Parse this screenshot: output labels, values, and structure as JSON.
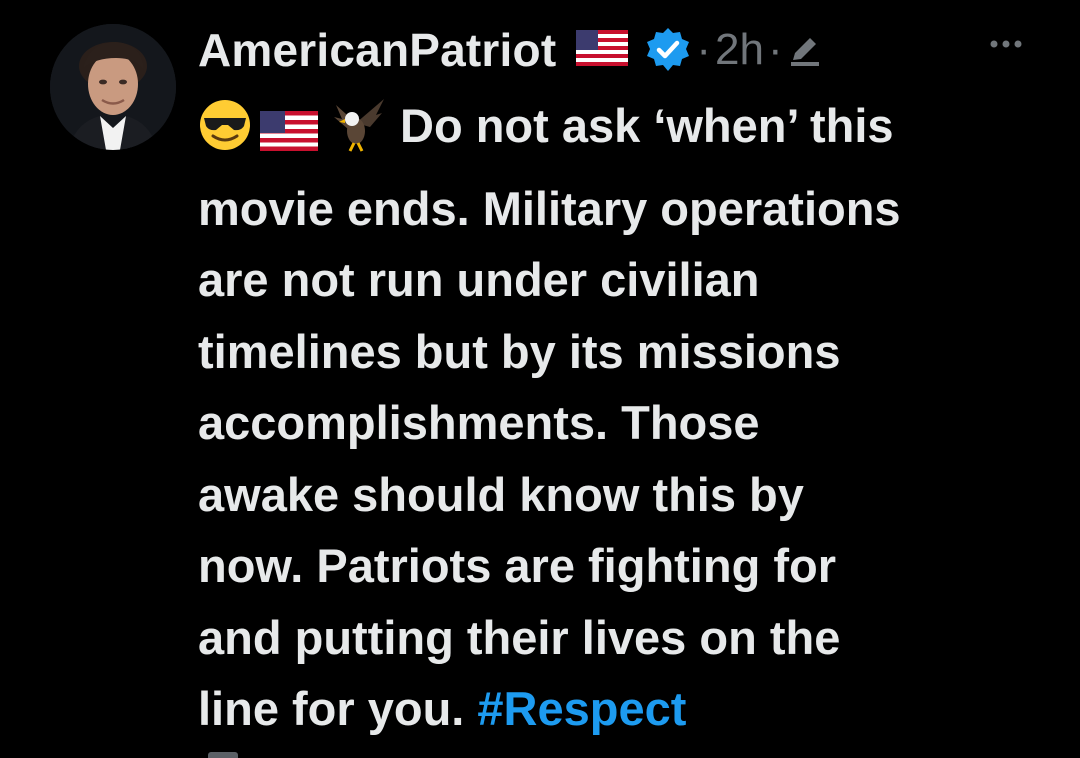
{
  "tweet": {
    "author": {
      "display_name": "AmericanPatriot",
      "badges": [
        "us-flag-emoji",
        "verified-badge"
      ],
      "avatar": "profile-photo"
    },
    "time_separator": "·",
    "relative_time": "2h",
    "separator2": "·",
    "edited_icon": "pencil-icon",
    "more_icon": "ellipsis-icon",
    "emojis": [
      "sunglasses-face-emoji",
      "us-flag-emoji",
      "eagle-emoji"
    ],
    "body_line_1": "Do not ask ‘when’ this",
    "body_line_2": "movie ends. Military operations",
    "body_line_3": "are not run under civilian",
    "body_line_4": "timelines but by its missions",
    "body_line_5": "accomplishments. Those",
    "body_line_6": "awake should know this by",
    "body_line_7": "now. Patriots are fighting for",
    "body_line_8": "and putting their lives on the",
    "body_line_9": "line for you.",
    "hashtag": "#Respect"
  },
  "colors": {
    "background": "#000000",
    "text": "#e7e9ea",
    "muted": "#71767b",
    "accent": "#1d9bf0"
  }
}
